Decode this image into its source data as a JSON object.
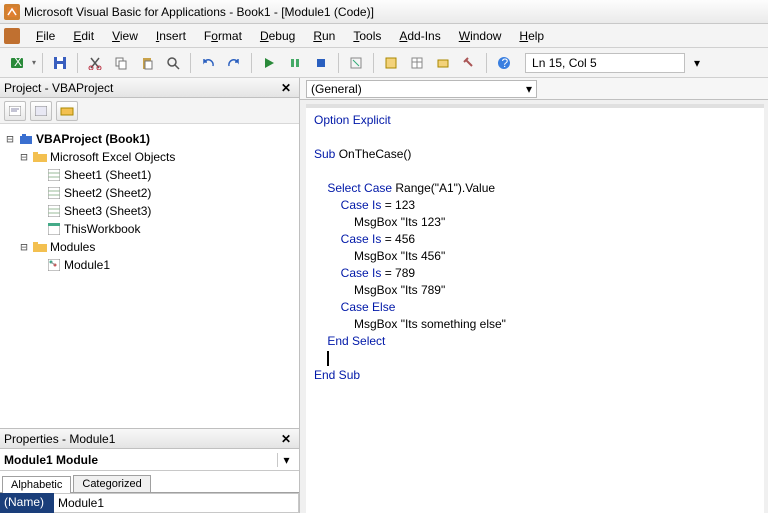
{
  "title": "Microsoft Visual Basic for Applications - Book1 - [Module1 (Code)]",
  "menus": [
    "File",
    "Edit",
    "View",
    "Insert",
    "Format",
    "Debug",
    "Run",
    "Tools",
    "Add-Ins",
    "Window",
    "Help"
  ],
  "cursor_position": "Ln 15, Col 5",
  "project_panel": {
    "title": "Project - VBAProject",
    "root": "VBAProject (Book1)",
    "excel_objects_label": "Microsoft Excel Objects",
    "sheets": [
      "Sheet1 (Sheet1)",
      "Sheet2 (Sheet2)",
      "Sheet3 (Sheet3)",
      "ThisWorkbook"
    ],
    "modules_label": "Modules",
    "modules": [
      "Module1"
    ]
  },
  "properties_panel": {
    "title": "Properties - Module1",
    "object_selector": "Module1 Module",
    "tabs": [
      "Alphabetic",
      "Categorized"
    ],
    "name_label": "(Name)",
    "name_value": "Module1"
  },
  "code_pane": {
    "general_label": "(General)",
    "lines": {
      "l1": "Option Explicit",
      "l2": "",
      "l3_a": "Sub",
      "l3_b": " OnTheCase()",
      "l4": "",
      "l5_a": "    Select Case",
      "l5_b": " Range(\"A1\").Value",
      "l6_a": "        Case Is",
      "l6_b": " = 123",
      "l7": "            MsgBox \"Its 123\"",
      "l8_a": "        Case Is",
      "l8_b": " = 456",
      "l9": "            MsgBox \"Its 456\"",
      "l10_a": "        Case Is",
      "l10_b": " = 789",
      "l11": "            MsgBox \"Its 789\"",
      "l12": "        Case Else",
      "l13": "            MsgBox \"Its something else\"",
      "l14": "    End Select",
      "l15": "    ",
      "l16": "End Sub"
    }
  }
}
